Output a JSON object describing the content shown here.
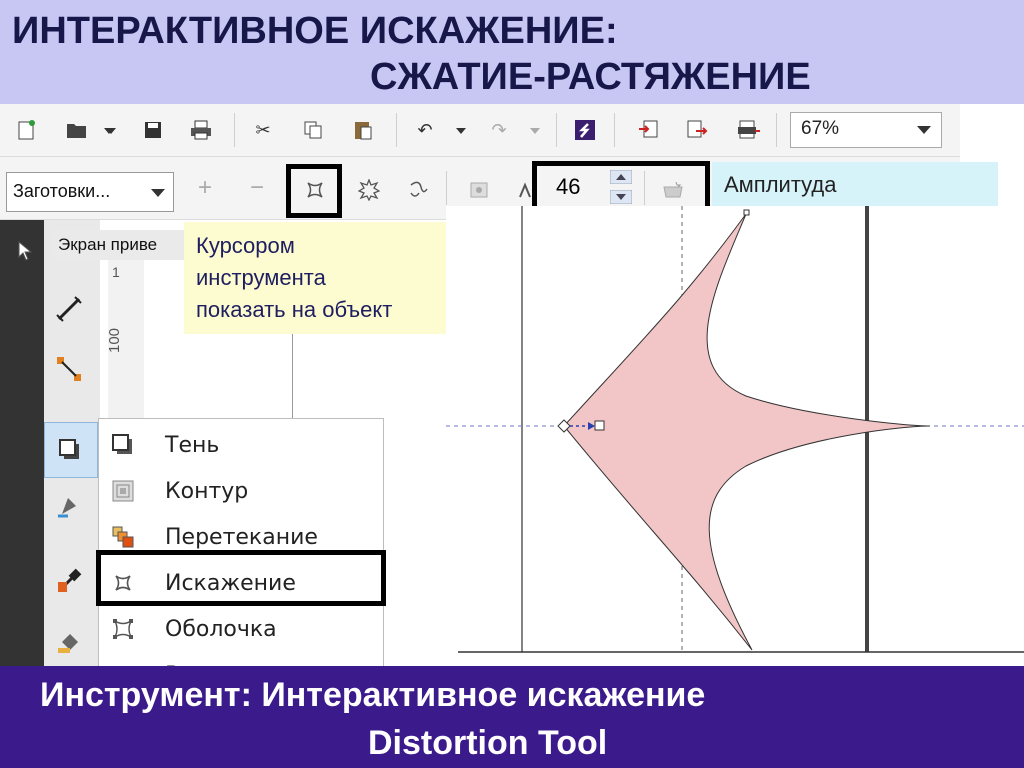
{
  "title": {
    "line1": "ИНТЕРАКТИВНОЕ ИСКАЖЕНИЕ:",
    "line2": "СЖАТИЕ-РАСТЯЖЕНИЕ"
  },
  "toolbar": {
    "zoom_value": "67%"
  },
  "property_bar": {
    "presets_label": "Заготовки...",
    "amplitude_value": "46"
  },
  "callouts": {
    "amplitude": "Амплитуда",
    "cursor_line1": "Курсором",
    "cursor_line2": "инструмента",
    "cursor_line3": "показать на объект"
  },
  "panel": {
    "screen_label": "Экран приве"
  },
  "ruler": {
    "mark1": "1",
    "mark100": "100"
  },
  "flyout_menu": {
    "items": [
      {
        "label": "Тень",
        "icon": "shadow-icon"
      },
      {
        "label": "Контур",
        "icon": "contour-icon"
      },
      {
        "label": "Перетекание",
        "icon": "blend-icon"
      },
      {
        "label": "Искажение",
        "icon": "distort-icon"
      },
      {
        "label": "Оболочка",
        "icon": "envelope-icon"
      },
      {
        "label": "В",
        "icon": "extrude-icon"
      }
    ]
  },
  "footer": {
    "line1": "Инструмент: Интерактивное искажение",
    "line2": "Distortion Tool"
  },
  "colors": {
    "title_bg": "#c8c7f4",
    "footer_bg": "#3b1a8c",
    "shape_fill": "#f2c6c6",
    "amplitude_callout_bg": "#d7f3fa",
    "cursor_callout_bg": "#fdfcd0"
  }
}
